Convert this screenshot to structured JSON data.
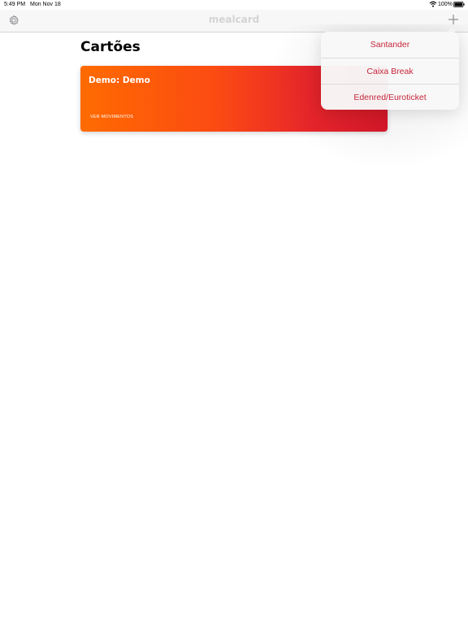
{
  "status_bar": {
    "time": "5:49 PM",
    "date": "Mon Nov 18",
    "battery_percent": "100%",
    "battery_level": 1.0,
    "wifi_icon": "wifi-icon",
    "battery_icon": "battery-icon"
  },
  "nav": {
    "logo": "mealcard",
    "settings_icon": "gear-icon",
    "add_icon": "plus-icon"
  },
  "page": {
    "title": "Cartões"
  },
  "cards": [
    {
      "title": "Demo: Demo",
      "link_label": "VER MOVIMENTOS",
      "gradient_start": "#ff6b00",
      "gradient_end": "#d9182a"
    }
  ],
  "add_menu": {
    "items": [
      {
        "label": "Santander"
      },
      {
        "label": "Caixa Break"
      },
      {
        "label": "Edenred/Euroticket"
      }
    ]
  },
  "colors": {
    "accent": "#c5263a",
    "nav_background": "#f7f7f7",
    "logo": "#d4d4d4"
  }
}
